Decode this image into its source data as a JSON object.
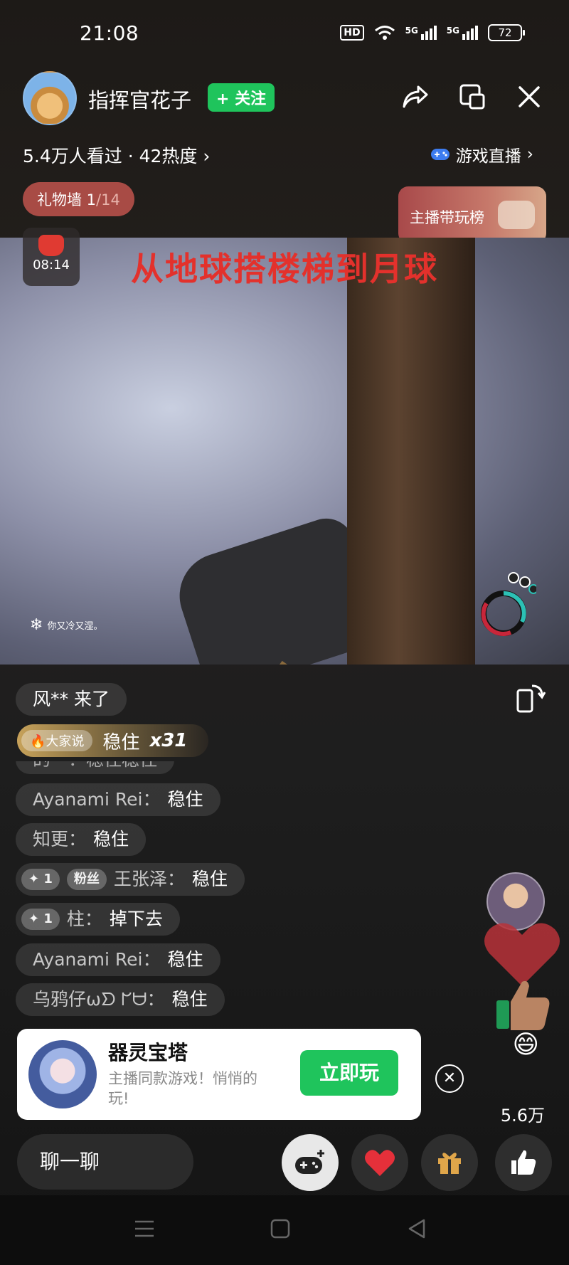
{
  "status_bar": {
    "time": "21:08",
    "hd": "HD",
    "net1": "5G",
    "net2": "5G",
    "battery": "72"
  },
  "header": {
    "streamer_name": "指挥官花子",
    "follow_label": "+ 关注",
    "viewers": "5.4万人看过 · 42热度 ›",
    "game_live_label": "游戏直播",
    "gift_wall_label": "礼物墙 1",
    "gift_wall_total": "/14",
    "rank_label": "主播带玩榜",
    "red_packet_timer": "08:14"
  },
  "video": {
    "overlay_title": "从地球搭楼梯到月球",
    "status_text": "你又冷又湿。"
  },
  "chat": {
    "join_msg": "风** 来了",
    "say_tag": "大家说",
    "say_text": "稳住",
    "say_count": "x31",
    "partial_msg": "的**：稳住稳住",
    "messages": [
      {
        "name": "Ayanami Rei：",
        "text": "稳住"
      },
      {
        "name": "知更：",
        "text": "稳住"
      },
      {
        "badge": "✦ 1",
        "badge2": "粉丝",
        "name": "王张泽：",
        "text": "稳住"
      },
      {
        "badge": "✦ 1",
        "name": "柱：",
        "text": "掉下去"
      },
      {
        "name": "Ayanami Rei：",
        "text": "稳住"
      },
      {
        "name": "乌鸦仔ωᗤ ᖸᗨ：",
        "text": "稳住"
      }
    ]
  },
  "game_card": {
    "name": "器灵宝塔",
    "desc": "主播同款游戏！悄悄的玩!",
    "play_label": "立即玩"
  },
  "likes": "5.6万",
  "bottom": {
    "chat_placeholder": "聊一聊"
  },
  "colors": {
    "accent_green": "#1fc45c",
    "title_red": "#e3312c"
  }
}
